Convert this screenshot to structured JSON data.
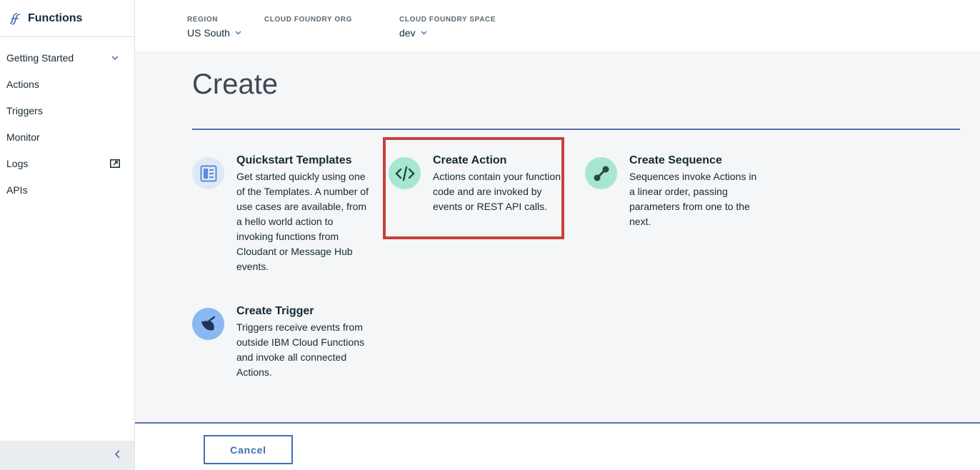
{
  "app": {
    "title": "Functions"
  },
  "sidebar": {
    "items": [
      {
        "label": "Getting Started",
        "trail": "chevron-down"
      },
      {
        "label": "Actions"
      },
      {
        "label": "Triggers"
      },
      {
        "label": "Monitor"
      },
      {
        "label": "Logs",
        "trail": "external-link"
      },
      {
        "label": "APIs"
      }
    ]
  },
  "header": {
    "region": {
      "label": "REGION",
      "value": "US South"
    },
    "org": {
      "label": "CLOUD FOUNDRY ORG",
      "value": ""
    },
    "space": {
      "label": "CLOUD FOUNDRY SPACE",
      "value": "dev"
    }
  },
  "main": {
    "title": "Create",
    "cards": [
      {
        "title": "Quickstart Templates",
        "desc": "Get started quickly using one of the Templates. A number of use cases are available, from a hello world action to invoking functions from Cloudant or Message Hub events.",
        "icon": "template-icon"
      },
      {
        "title": "Create Action",
        "desc": "Actions contain your function code and are invoked by events or REST API calls.",
        "icon": "code-icon"
      },
      {
        "title": "Create Sequence",
        "desc": "Sequences invoke Actions in a linear order, passing parameters from one to the next.",
        "icon": "sequence-icon"
      },
      {
        "title": "Create Trigger",
        "desc": "Triggers receive events from outside IBM Cloud Functions and invoke all connected Actions.",
        "icon": "trigger-icon"
      }
    ]
  },
  "footer": {
    "cancel_label": "Cancel"
  },
  "colors": {
    "accent": "#3d70b2",
    "highlight": "#c8413a",
    "rule": "#5a6fa8",
    "action_icon_bg": "#a7e6d0",
    "trigger_icon_bg": "#8bb8f0",
    "template_icon_bg": "#e0e8f6"
  }
}
